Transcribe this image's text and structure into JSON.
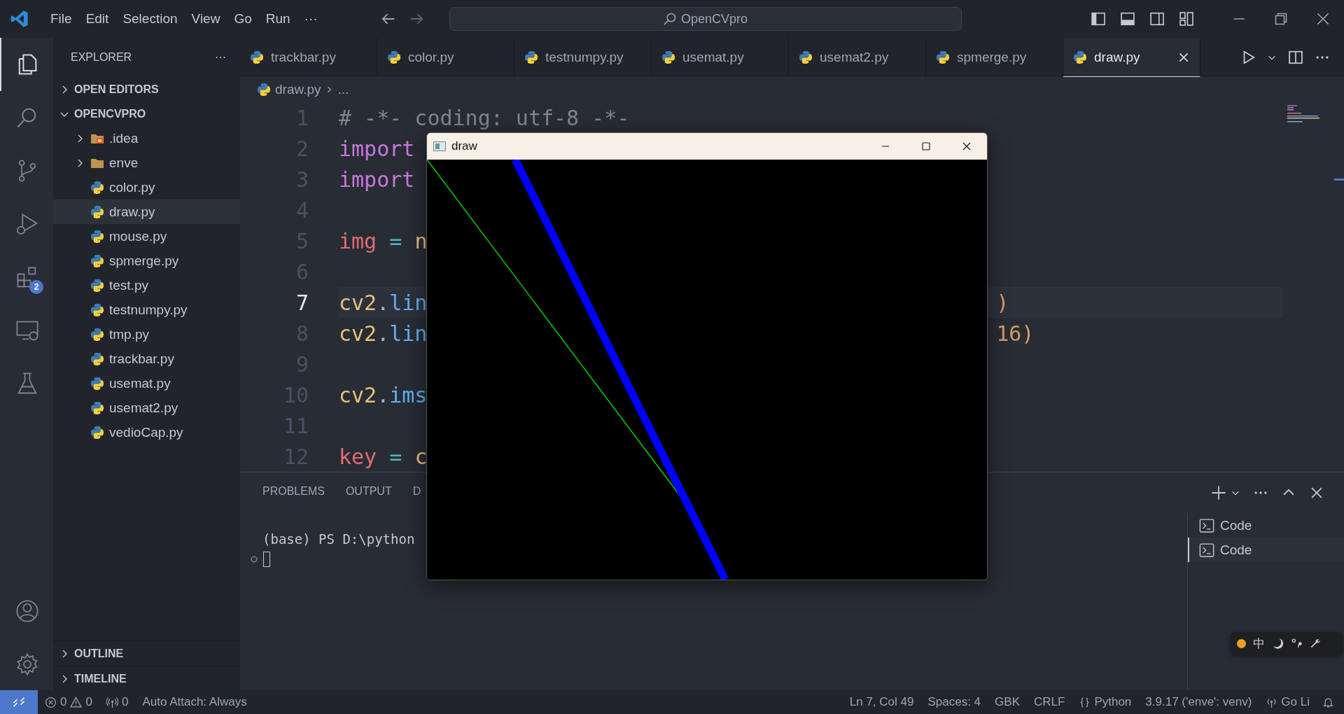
{
  "title_bar": {
    "menu": [
      "File",
      "Edit",
      "Selection",
      "View",
      "Go",
      "Run",
      "···"
    ],
    "search": "OpenCVpro"
  },
  "activity_bar": {
    "items": [
      {
        "kind": "explorer",
        "selected": true
      },
      {
        "kind": "search",
        "selected": false
      },
      {
        "kind": "source-control",
        "selected": false
      },
      {
        "kind": "run-debug",
        "selected": false
      },
      {
        "kind": "extensions",
        "selected": false,
        "badge": "2"
      },
      {
        "kind": "remote",
        "selected": false
      },
      {
        "kind": "testing",
        "selected": false
      }
    ],
    "bottom": [
      {
        "kind": "account"
      },
      {
        "kind": "settings"
      }
    ]
  },
  "sidebar": {
    "title": "EXPLORER",
    "more": "···",
    "sections": [
      {
        "label": "OPEN EDITORS",
        "expanded": false
      },
      {
        "label": "OPENCVPRO",
        "expanded": true,
        "children": [
          {
            "label": ".idea",
            "kind": "idea-folder",
            "expanded": false,
            "selected": false
          },
          {
            "label": "enve",
            "kind": "folder",
            "expanded": false,
            "selected": false
          },
          {
            "label": "color.py",
            "kind": "python",
            "selected": false
          },
          {
            "label": "draw.py",
            "kind": "python",
            "selected": true
          },
          {
            "label": "mouse.py",
            "kind": "python",
            "selected": false
          },
          {
            "label": "spmerge.py",
            "kind": "python",
            "selected": false
          },
          {
            "label": "test.py",
            "kind": "python",
            "selected": false
          },
          {
            "label": "testnumpy.py",
            "kind": "python",
            "selected": false
          },
          {
            "label": "tmp.py",
            "kind": "python",
            "selected": false
          },
          {
            "label": "trackbar.py",
            "kind": "python",
            "selected": false
          },
          {
            "label": "usemat.py",
            "kind": "python",
            "selected": false
          },
          {
            "label": "usemat2.py",
            "kind": "python",
            "selected": false
          },
          {
            "label": "vedioCap.py",
            "kind": "python",
            "selected": false
          }
        ]
      }
    ],
    "bottom_sections": [
      {
        "label": "OUTLINE",
        "expanded": false
      },
      {
        "label": "TIMELINE",
        "expanded": false
      }
    ]
  },
  "tabs": [
    {
      "label": "trackbar.py",
      "selected": false
    },
    {
      "label": "color.py",
      "selected": false
    },
    {
      "label": "testnumpy.py",
      "selected": false
    },
    {
      "label": "usemat.py",
      "selected": false
    },
    {
      "label": "usemat2.py",
      "selected": false
    },
    {
      "label": "spmerge.py",
      "selected": false
    },
    {
      "label": "draw.py",
      "selected": true
    }
  ],
  "breadcrumb": [
    "draw.py",
    "..."
  ],
  "editor": {
    "lines": [
      {
        "number": "1",
        "current": false,
        "tokens": [
          {
            "text": "# -*- coding: utf-8 -*-",
            "kind": "comment"
          }
        ]
      },
      {
        "number": "2",
        "current": false,
        "tokens": [
          {
            "text": "import",
            "kind": "keyword"
          }
        ]
      },
      {
        "number": "3",
        "current": false,
        "tokens": [
          {
            "text": "import",
            "kind": "keyword"
          }
        ]
      },
      {
        "number": "4",
        "current": false
      },
      {
        "number": "5",
        "current": false,
        "tokens": [
          {
            "text": "img",
            "kind": "variable"
          },
          {
            "text": " = ",
            "kind": "operator"
          },
          {
            "text": "n",
            "kind": "module"
          }
        ]
      },
      {
        "number": "6",
        "current": false
      },
      {
        "number": "7",
        "current": true,
        "tokens": [
          {
            "text": "cv2",
            "kind": "module"
          },
          {
            "text": ".",
            "kind": "punctuation"
          },
          {
            "text": "lin",
            "kind": "function"
          }
        ],
        "right": [
          {
            "text": ")",
            "kind": "bracket"
          }
        ]
      },
      {
        "number": "8",
        "current": false,
        "tokens": [
          {
            "text": "cv2",
            "kind": "module"
          },
          {
            "text": ".",
            "kind": "punctuation"
          },
          {
            "text": "lin",
            "kind": "function"
          }
        ],
        "right": [
          {
            "text": "16",
            "kind": "number"
          },
          {
            "text": ")",
            "kind": "bracket"
          }
        ]
      },
      {
        "number": "9",
        "current": false
      },
      {
        "number": "10",
        "current": false,
        "tokens": [
          {
            "text": "cv2",
            "kind": "module"
          },
          {
            "text": ".",
            "kind": "punctuation"
          },
          {
            "text": "ims",
            "kind": "function"
          }
        ]
      },
      {
        "number": "11",
        "current": false
      },
      {
        "number": "12",
        "current": false,
        "tokens": [
          {
            "text": "key",
            "kind": "variable"
          },
          {
            "text": " = ",
            "kind": "operator"
          },
          {
            "text": "c",
            "kind": "module"
          }
        ]
      }
    ]
  },
  "panel": {
    "tabs": [
      {
        "label": "PROBLEMS",
        "selected": false
      },
      {
        "label": "OUTPUT",
        "selected": false
      },
      {
        "label": "D",
        "selected": false
      }
    ],
    "terminal_lines": [
      "(base) PS D:\\python"
    ],
    "terminals": [
      {
        "label": "Code",
        "selected": false
      },
      {
        "label": "Code",
        "selected": true
      }
    ]
  },
  "image_window": {
    "title": "draw"
  },
  "ime_bar": {
    "mode": "中"
  },
  "status_bar": {
    "errors": "0",
    "warnings": "0",
    "ports": "0",
    "auto_attach": "Auto Attach: Always",
    "items": [
      "Ln 7, Col 49",
      "Spaces: 4",
      "GBK",
      "CRLF"
    ],
    "language": "Python",
    "interpreter": "3.9.17 ('enve': venv)",
    "live": "Go Li"
  }
}
